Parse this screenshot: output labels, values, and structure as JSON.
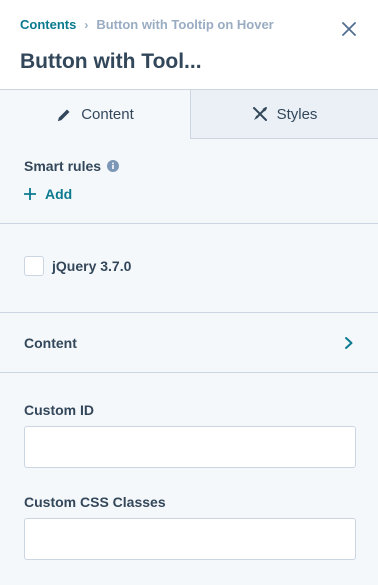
{
  "header": {
    "breadcrumb_root": "Contents",
    "breadcrumb_separator": "›",
    "breadcrumb_current": "Button with Tooltip on Hover",
    "title": "Button with Tool..."
  },
  "tabs": [
    {
      "label": "Content",
      "icon": "pencil-icon",
      "active": true
    },
    {
      "label": "Styles",
      "icon": "brush-icon",
      "active": false
    }
  ],
  "smart_rules": {
    "label": "Smart rules",
    "add_label": "Add"
  },
  "jquery_checkbox": {
    "label": "jQuery 3.7.0",
    "checked": false
  },
  "content_accordion": {
    "label": "Content"
  },
  "custom_id": {
    "label": "Custom ID",
    "value": ""
  },
  "custom_css": {
    "label": "Custom CSS Classes",
    "value": ""
  },
  "colors": {
    "accent": "#0b7a8f",
    "text": "#33475b",
    "muted": "#99acc2",
    "border": "#cbd6e2",
    "panel": "#f5f8fa"
  }
}
